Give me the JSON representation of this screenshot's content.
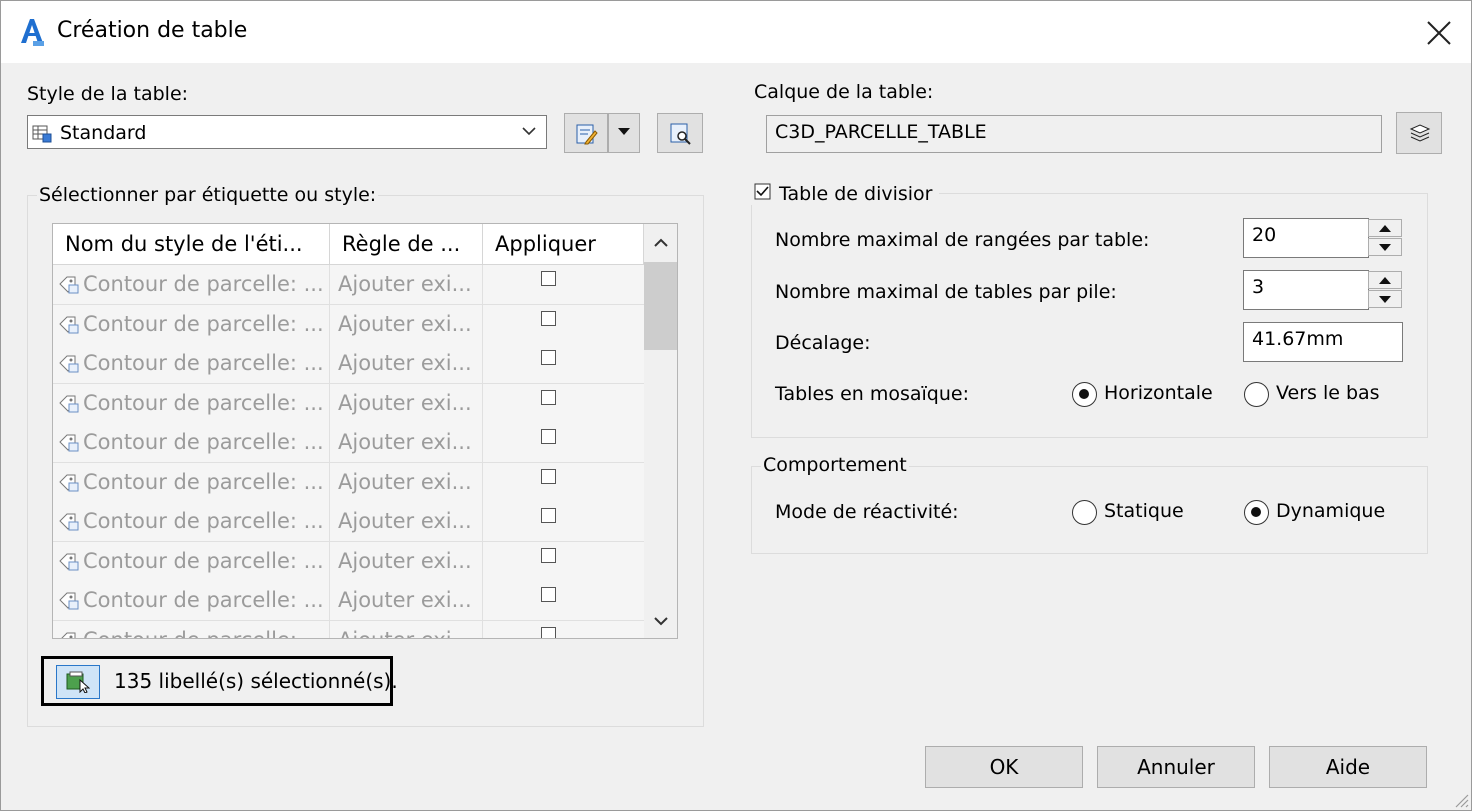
{
  "window": {
    "title": "Création de table"
  },
  "style": {
    "label": "Style de la table:",
    "selected": "Standard"
  },
  "selection_group": {
    "label": "Sélectionner par étiquette ou style:",
    "columns": [
      "Nom du style de l'éti...",
      "Règle de ...",
      "Appliquer"
    ],
    "rows": [
      {
        "name": "Contour de parcelle: ...",
        "rule": "Ajouter exi...",
        "apply": false
      },
      {
        "name": "Contour de parcelle: ...",
        "rule": "Ajouter exi...",
        "apply": false
      },
      {
        "name": "Contour de parcelle: ...",
        "rule": "Ajouter exi...",
        "apply": false
      },
      {
        "name": "Contour de parcelle: ...",
        "rule": "Ajouter exi...",
        "apply": false
      },
      {
        "name": "Contour de parcelle: ...",
        "rule": "Ajouter exi...",
        "apply": false
      },
      {
        "name": "Contour de parcelle: ...",
        "rule": "Ajouter exi...",
        "apply": false
      },
      {
        "name": "Contour de parcelle: ...",
        "rule": "Ajouter exi...",
        "apply": false
      },
      {
        "name": "Contour de parcelle: ...",
        "rule": "Ajouter exi...",
        "apply": false
      },
      {
        "name": "Contour de parcelle: ...",
        "rule": "Ajouter exi...",
        "apply": false
      },
      {
        "name": "Contour de parcelle: ...",
        "rule": "Ajouter exi...",
        "apply": false
      }
    ],
    "status": "135 libellé(s) sélectionné(s)."
  },
  "layer": {
    "label": "Calque de la table:",
    "value": "C3D_PARCELLE_TABLE"
  },
  "split": {
    "checkbox_label": "Table de divisior",
    "checked": true,
    "max_rows_label": "Nombre maximal de rangées par table:",
    "max_rows_value": "20",
    "max_tables_label": "Nombre maximal de tables par pile:",
    "max_tables_value": "3",
    "offset_label": "Décalage:",
    "offset_value": "41.67mm",
    "tiling_label": "Tables en mosaïque:",
    "tiling_options": [
      "Horizontale",
      "Vers le bas"
    ],
    "tiling_selected": "Horizontale"
  },
  "behavior": {
    "group_label": "Comportement",
    "mode_label": "Mode de réactivité:",
    "options": [
      "Statique",
      "Dynamique"
    ],
    "selected": "Dynamique"
  },
  "buttons": {
    "ok": "OK",
    "cancel": "Annuler",
    "help": "Aide"
  },
  "colors": {
    "accent_blue": "#2a77c9",
    "app_icon": "#1f6fd0"
  }
}
